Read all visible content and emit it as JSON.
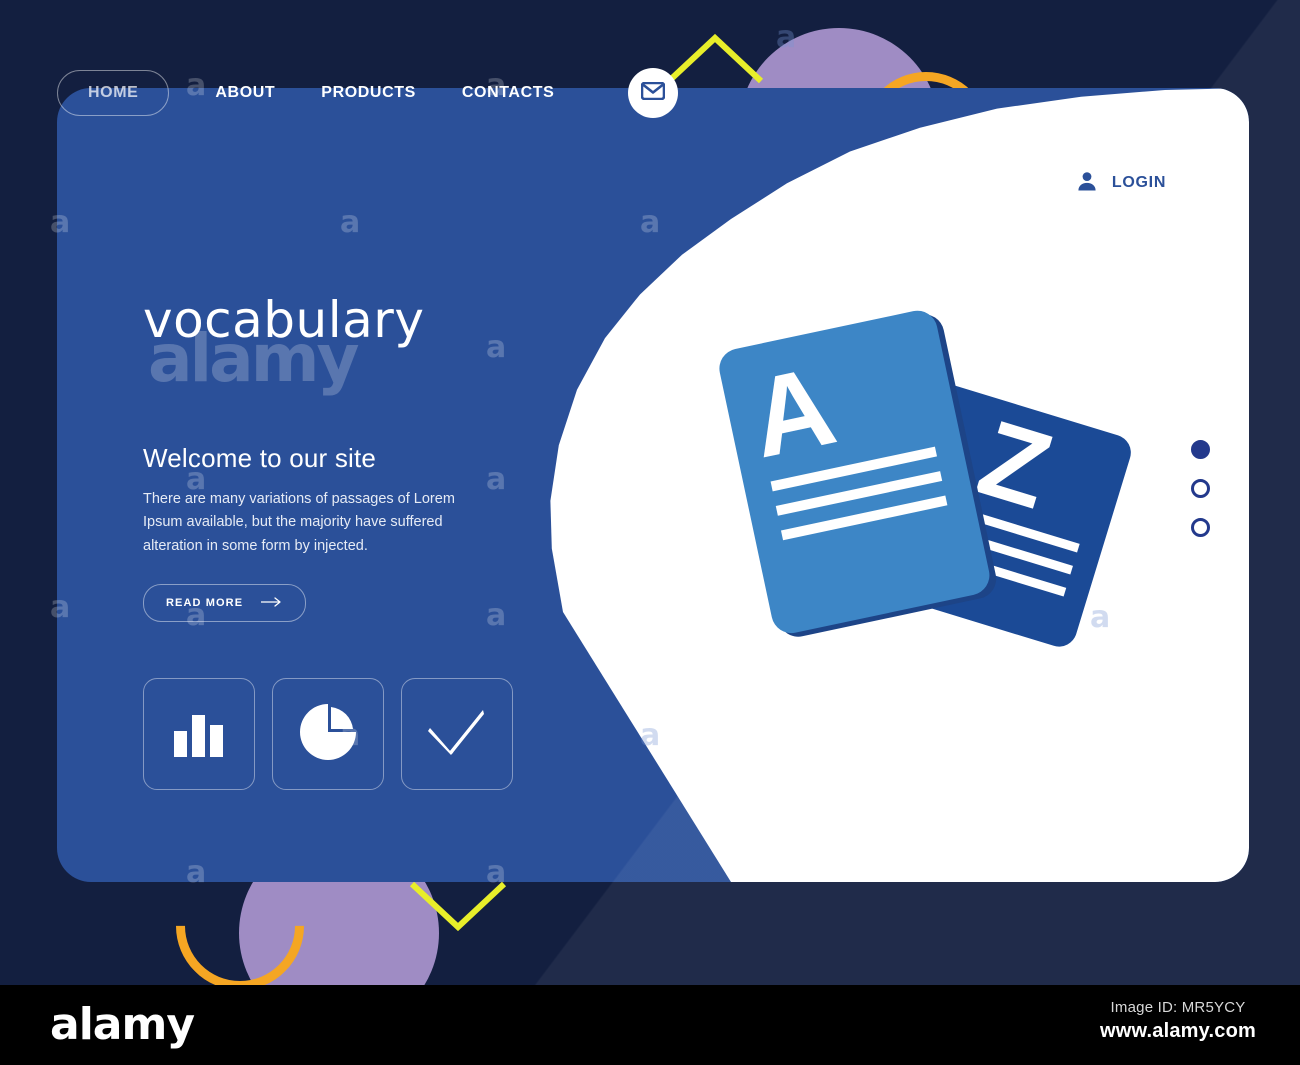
{
  "colors": {
    "page_background": "#131f40",
    "card_blue": "#2b5099",
    "panel_white": "#ffffff",
    "accent_dark_blue": "#23398c",
    "card_light_blue": "#3d86c6",
    "card_dark_blue": "#1b4a96",
    "deco_purple": "#9f8cc4",
    "deco_orange": "#f5a623",
    "deco_yellow": "#e8ee2a",
    "footer_black": "#000000"
  },
  "nav": {
    "home": "HOME",
    "items": [
      {
        "label": "ABOUT"
      },
      {
        "label": "PRODUCTS"
      },
      {
        "label": "CONTACTS"
      }
    ],
    "mail_icon": "envelope-icon"
  },
  "login": {
    "label": "LOGIN",
    "icon": "user-icon"
  },
  "hero": {
    "title": "vocabulary",
    "subtitle": "Welcome to our site",
    "body": "There are many variations of passages of Lorem Ipsum available, but the majority have suffered alteration in some form by injected.",
    "cta_label": "READ MORE",
    "cta_icon": "arrow-right-icon"
  },
  "tiles": [
    {
      "name": "bar-chart-icon"
    },
    {
      "name": "pie-chart-icon"
    },
    {
      "name": "check-icon"
    }
  ],
  "illustration": {
    "card_front_letter": "A",
    "card_back_letter": "Z",
    "front_lines": 3,
    "back_lines": 3
  },
  "carousel": {
    "dots": [
      {
        "active": true
      },
      {
        "active": false
      },
      {
        "active": false
      }
    ]
  },
  "watermark": {
    "mark": "a",
    "big": "alamy"
  },
  "footer": {
    "logo": "alamy",
    "image_id": "Image ID: MR5YCY",
    "url": "www.alamy.com"
  }
}
